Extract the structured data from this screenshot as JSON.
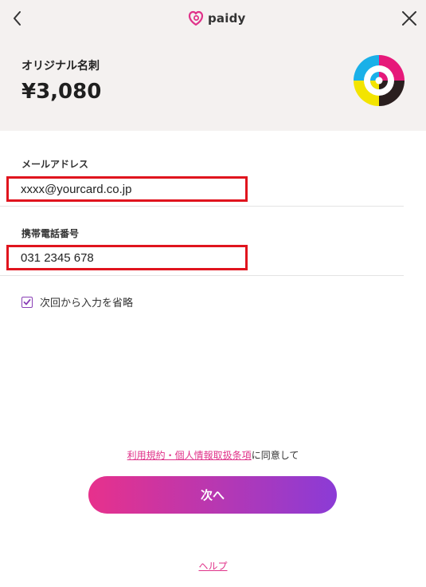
{
  "header": {
    "brand": "paidy",
    "back_icon": "chevron-left-icon",
    "close_icon": "close-icon",
    "bg_color": "#f4f1f0"
  },
  "merchant": {
    "name": "オリジナル名刺",
    "amount": "¥3,080",
    "logo_icon": "merchant-logo-icon"
  },
  "form": {
    "email": {
      "label": "メールアドレス",
      "value": "xxxx@yourcard.co.jp"
    },
    "phone": {
      "label": "携帯電話番号",
      "value": "031 2345 678"
    },
    "remember": {
      "label": "次回から入力を省略",
      "checked": true
    }
  },
  "terms": {
    "link": "利用規約・個人情報取扱条項",
    "suffix": "に同意して"
  },
  "next_button": {
    "label": "次へ"
  },
  "help": {
    "label": "ヘルプ"
  },
  "colors": {
    "accent_pink": "#e0338a",
    "accent_purple": "#8b3bd6",
    "highlight_red": "#e0141e"
  }
}
